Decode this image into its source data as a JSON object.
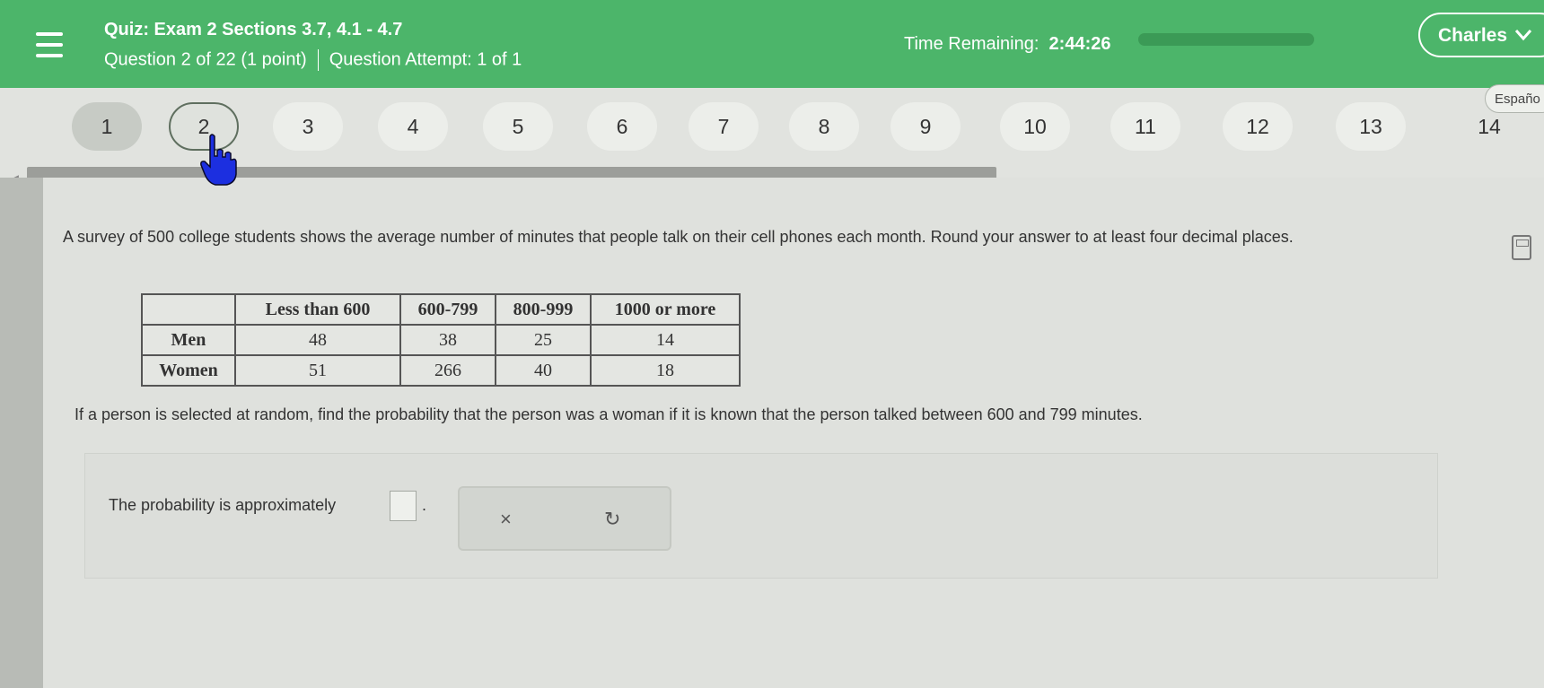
{
  "header": {
    "quiz_title": "Quiz: Exam 2 Sections 3.7, 4.1 - 4.7",
    "question_info": "Question 2 of 22 (1 point)",
    "attempt_info": "Question Attempt: 1 of 1",
    "time_label": "Time Remaining:",
    "time_value": "2:44:26",
    "user_name": "Charles"
  },
  "question_nav": {
    "items": [
      "1",
      "2",
      "3",
      "4",
      "5",
      "6",
      "7",
      "8",
      "9",
      "10",
      "11",
      "12",
      "13",
      "14"
    ],
    "current": "2",
    "language_button": "Españo"
  },
  "question": {
    "text": "A survey of 500 college students shows the average number of minutes that people talk on their cell phones each month. Round your answer to at least four decimal places.",
    "table": {
      "columns": [
        "",
        "Less than 600",
        "600-799",
        "800-999",
        "1000 or more"
      ],
      "rows": [
        {
          "label": "Men",
          "values": [
            "48",
            "38",
            "25",
            "14"
          ]
        },
        {
          "label": "Women",
          "values": [
            "51",
            "266",
            "40",
            "18"
          ]
        }
      ]
    },
    "prompt": "If a person is selected at random, find the probability that the person was a woman if it is known that the person talked between 600 and 799 minutes."
  },
  "answer": {
    "label": "The probability is approximately",
    "value": "",
    "suffix": ".",
    "clear_icon": "×",
    "undo_icon": "↻"
  },
  "icons": {
    "menu": "hamburger-icon",
    "chevron": "chevron-down-icon",
    "calculator": "calculator-icon",
    "cursor": "hand-pointer-icon"
  },
  "colors": {
    "header_green": "#4cb56a",
    "background": "#dfe1dd"
  }
}
